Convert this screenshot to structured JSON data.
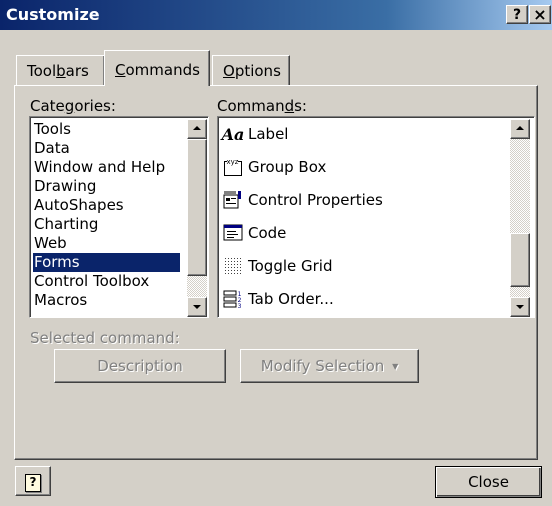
{
  "window": {
    "title": "Customize",
    "help_glyph": "?",
    "close_glyph": "×"
  },
  "tabs": [
    {
      "pre": "Tool",
      "key": "b",
      "post": "ars"
    },
    {
      "pre": "",
      "key": "C",
      "post": "ommands"
    },
    {
      "pre": "",
      "key": "O",
      "post": "ptions"
    }
  ],
  "categories": {
    "label_pre": "Cate",
    "label_key": "g",
    "label_post": "ories:",
    "items": [
      "Tools",
      "Data",
      "Window and Help",
      "Drawing",
      "AutoShapes",
      "Charting",
      "Web",
      "Forms",
      "Control Toolbox",
      "Macros"
    ],
    "selected": "Forms"
  },
  "commands": {
    "label_pre": "Comman",
    "label_key": "d",
    "label_post": "s:",
    "items": [
      {
        "icon": "label-icon",
        "label": "Label",
        "glyph": "Aa"
      },
      {
        "icon": "group-box-icon",
        "label": "Group Box",
        "glyph": "xyz"
      },
      {
        "icon": "control-properties-icon",
        "label": "Control Properties"
      },
      {
        "icon": "code-icon",
        "label": "Code"
      },
      {
        "icon": "toggle-grid-icon",
        "label": "Toggle Grid"
      },
      {
        "icon": "tab-order-icon",
        "label": "Tab Order..."
      }
    ]
  },
  "selected_command": {
    "label": "Selected command:",
    "description_button": "Description",
    "modify_button": "Modify Selection",
    "modify_arrow": "▼"
  },
  "footer": {
    "help_glyph": "?",
    "close_button": "Close"
  },
  "colors": {
    "titlebar": "#0a246a",
    "selection": "#0a246a",
    "face": "#d4d0c8"
  }
}
